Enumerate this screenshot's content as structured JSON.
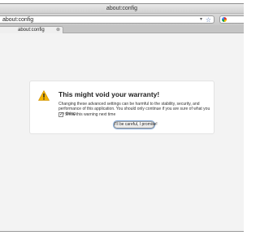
{
  "window": {
    "title": "about:config"
  },
  "navbar": {
    "url": "about:config",
    "dropdown_icon": "dropdown-arrow-icon",
    "bookmark_icon": "star-icon",
    "search_engine_icon": "google-icon"
  },
  "tabs": [
    {
      "label": "about:config",
      "close_icon": "close-icon"
    }
  ],
  "warning": {
    "icon": "warning-icon",
    "title": "This might void your warranty!",
    "body": "Changing these advanced settings can be harmful to the stability, security, and performance of this application. You should only continue if you are sure of what you are doing.",
    "checkbox_label": "Show this warning next time",
    "checkbox_checked": true,
    "button_label": "I'll be careful, I promise!"
  },
  "colors": {
    "warning_icon": "#f5b400",
    "star": "#4a6fb0",
    "button_focus": "#7fa7d8"
  }
}
